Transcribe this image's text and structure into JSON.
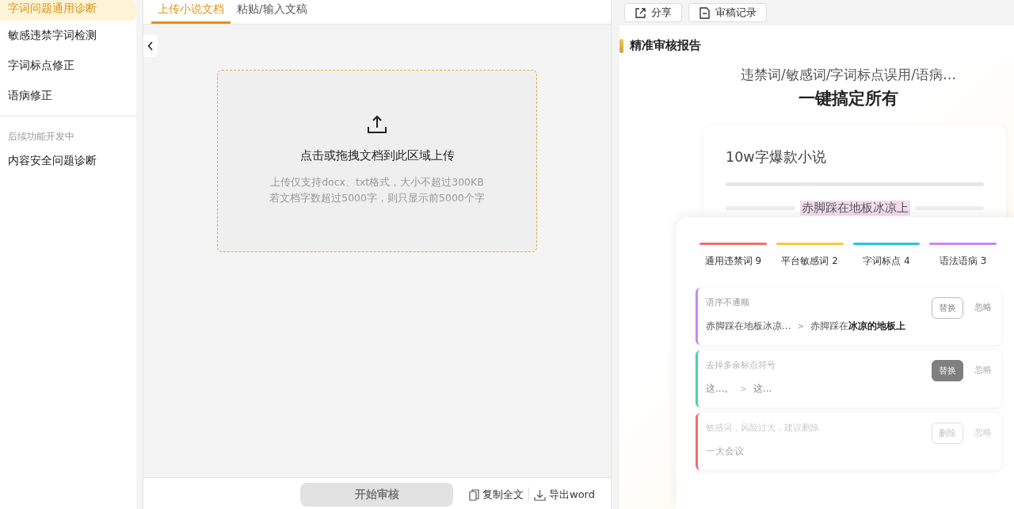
{
  "sidebar": {
    "items": [
      {
        "label": "字词问题通用诊断",
        "selected": true
      },
      {
        "label": "敏感违禁字词检测",
        "selected": false
      },
      {
        "label": "字词标点修正",
        "selected": false
      },
      {
        "label": "语病修正",
        "selected": false
      }
    ],
    "section_label": "后续功能开发中",
    "more_items": [
      {
        "label": "内容安全问题诊断",
        "selected": false
      }
    ]
  },
  "editor": {
    "tabs": [
      {
        "label": "上传小说文档",
        "selected": true
      },
      {
        "label": "粘贴/输入文稿",
        "selected": false
      }
    ],
    "upload": {
      "title": "点击或拖拽文档到此区域上传",
      "hints": [
        "上传仅支持docx、txt格式，大小不超过300KB",
        "若文档字数超过5000字，则只显示前5000个字"
      ]
    },
    "start_button": {
      "label": "开始审核",
      "disabled": true
    },
    "actions": [
      {
        "label": "复制全文",
        "kind": "copy"
      },
      {
        "label": "导出word",
        "kind": "download"
      }
    ]
  },
  "report": {
    "toolbar": [
      {
        "label": "分享",
        "kind": "share"
      },
      {
        "label": "审稿记录",
        "kind": "record"
      }
    ],
    "title": "精准审核报告",
    "promo": {
      "subtitle": "违禁词/敏感词/字词标点误用/语病…",
      "headline": "一键搞定所有",
      "doc_title": "10w字爆款小说",
      "doc_highlight": "赤脚踩在地板冰凉上",
      "categories": [
        {
          "label": "通用违禁词 9",
          "color": "#f56c6c"
        },
        {
          "label": "平台敏感词 2",
          "color": "#fbc73f"
        },
        {
          "label": "字词标点 4",
          "color": "#22c7e0"
        },
        {
          "label": "语法语病 3",
          "color": "#c58af8"
        }
      ],
      "issues": [
        {
          "hint": "语序不通顺",
          "original": "赤脚踩在地板冰凉...",
          "separator": ">",
          "replacement": "赤脚踩在**冰凉的地板上**",
          "action": "替换",
          "action_active": false,
          "ignore": "忽略",
          "color": "#c58af8"
        },
        {
          "hint": "去掉多余标点符号",
          "original": "这...。",
          "separator": ">",
          "replacement": "这...",
          "action": "替换",
          "action_active": true,
          "ignore": "忽略",
          "color": "#4fd1a5"
        },
        {
          "hint": "敏感词，风险过大，建议删除",
          "original": "一大会议",
          "action": "删除",
          "action_active": false,
          "ignore": "忽略",
          "color": "#f56c6c"
        }
      ]
    }
  }
}
